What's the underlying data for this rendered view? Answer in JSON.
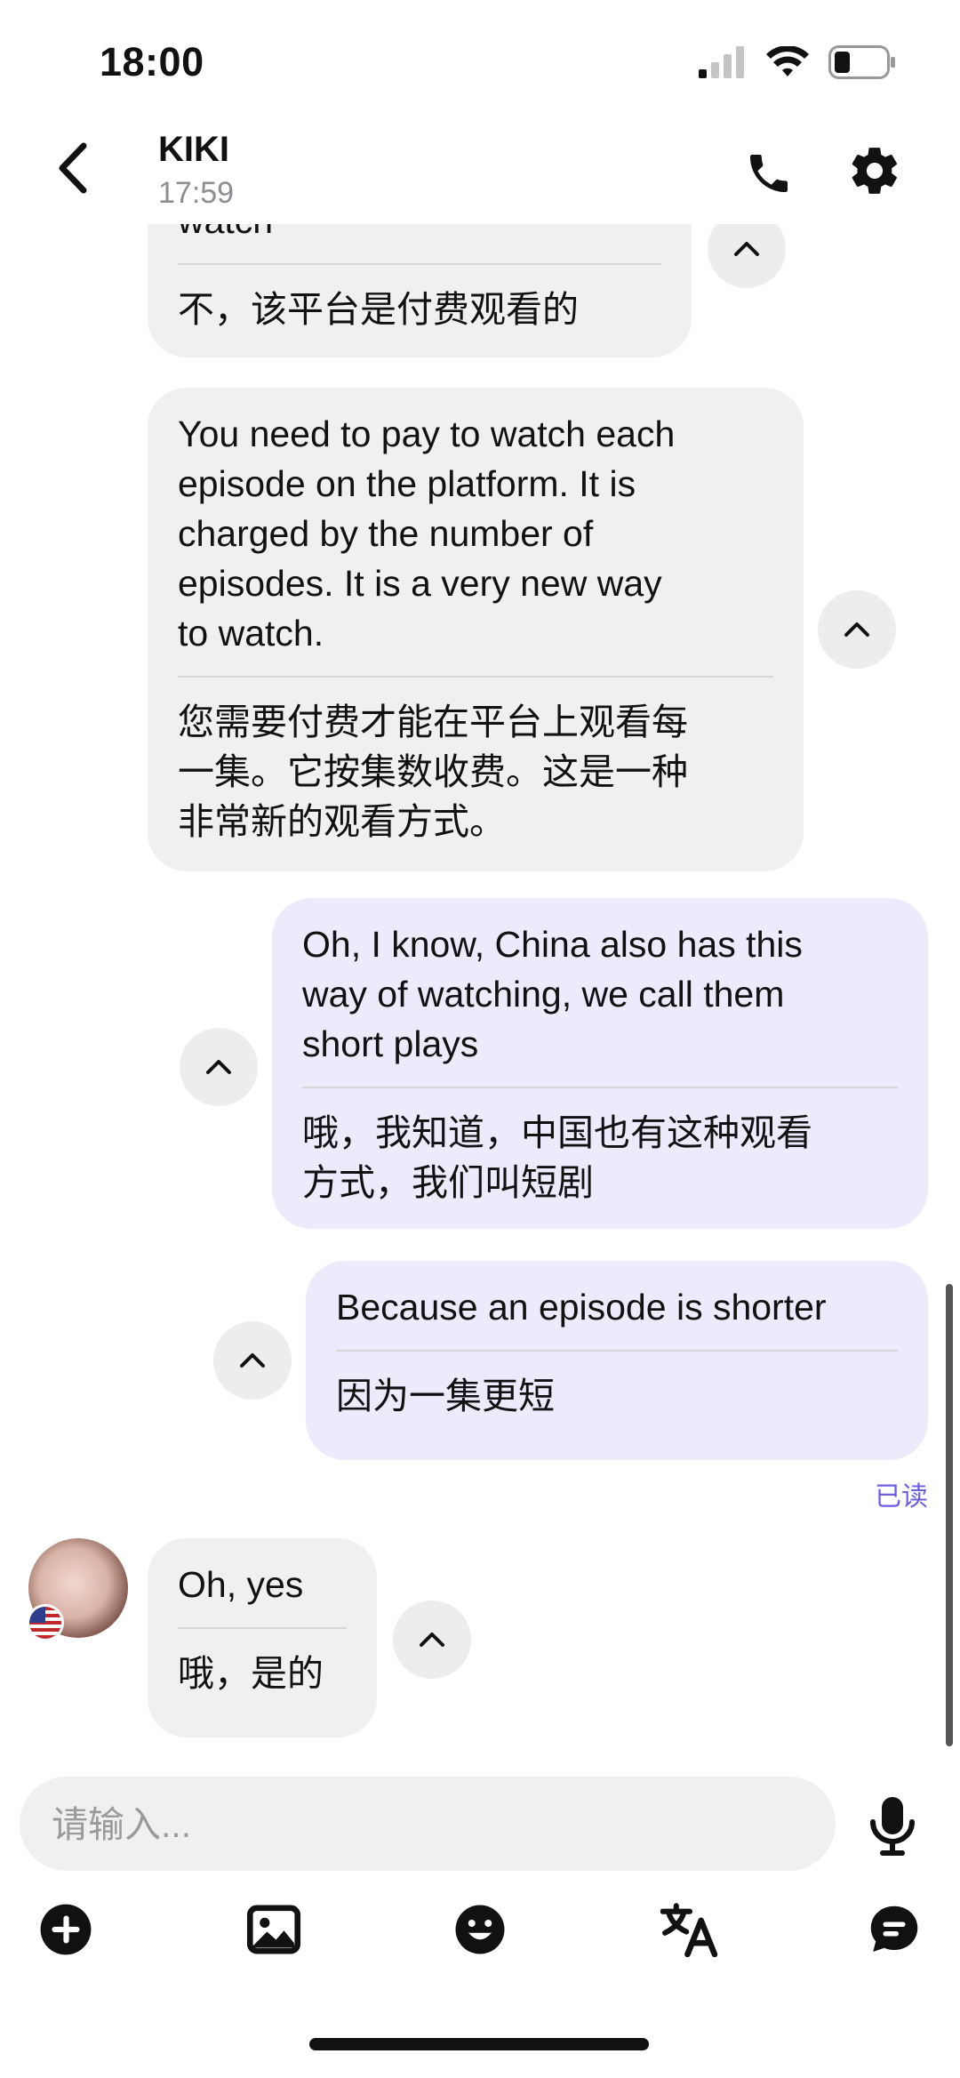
{
  "status_bar": {
    "time": "18:00"
  },
  "header": {
    "name": "KIKI",
    "last_seen": "17:59"
  },
  "messages": [
    {
      "side": "in",
      "original": "watch",
      "translation": "不，该平台是付费观看的"
    },
    {
      "side": "in",
      "original": "You need to pay to watch each\nepisode on the platform. It is\ncharged by the number of\nepisodes. It is a very new way\nto watch.",
      "translation": "您需要付费才能在平台上观看每\n一集。它按集数收费。这是一种\n非常新的观看方式。"
    },
    {
      "side": "out",
      "original": "Oh, I know, China also has this\nway of watching, we call them\nshort plays",
      "translation": "哦，我知道，中国也有这种观看\n方式，我们叫短剧"
    },
    {
      "side": "out",
      "original": "Because an episode is shorter",
      "translation": "因为一集更短"
    },
    {
      "side": "in",
      "original": "Oh, yes",
      "translation": "哦，是的"
    }
  ],
  "read_receipt": "已读",
  "composer": {
    "placeholder": "请输入..."
  },
  "colors": {
    "incoming_bubble": "#f0f0f0",
    "outgoing_bubble": "#ecebfb",
    "accent": "#6b5fe0"
  },
  "toolbar": [
    "add-icon",
    "image-icon",
    "emoji-icon",
    "translate-icon",
    "chat-icon"
  ]
}
